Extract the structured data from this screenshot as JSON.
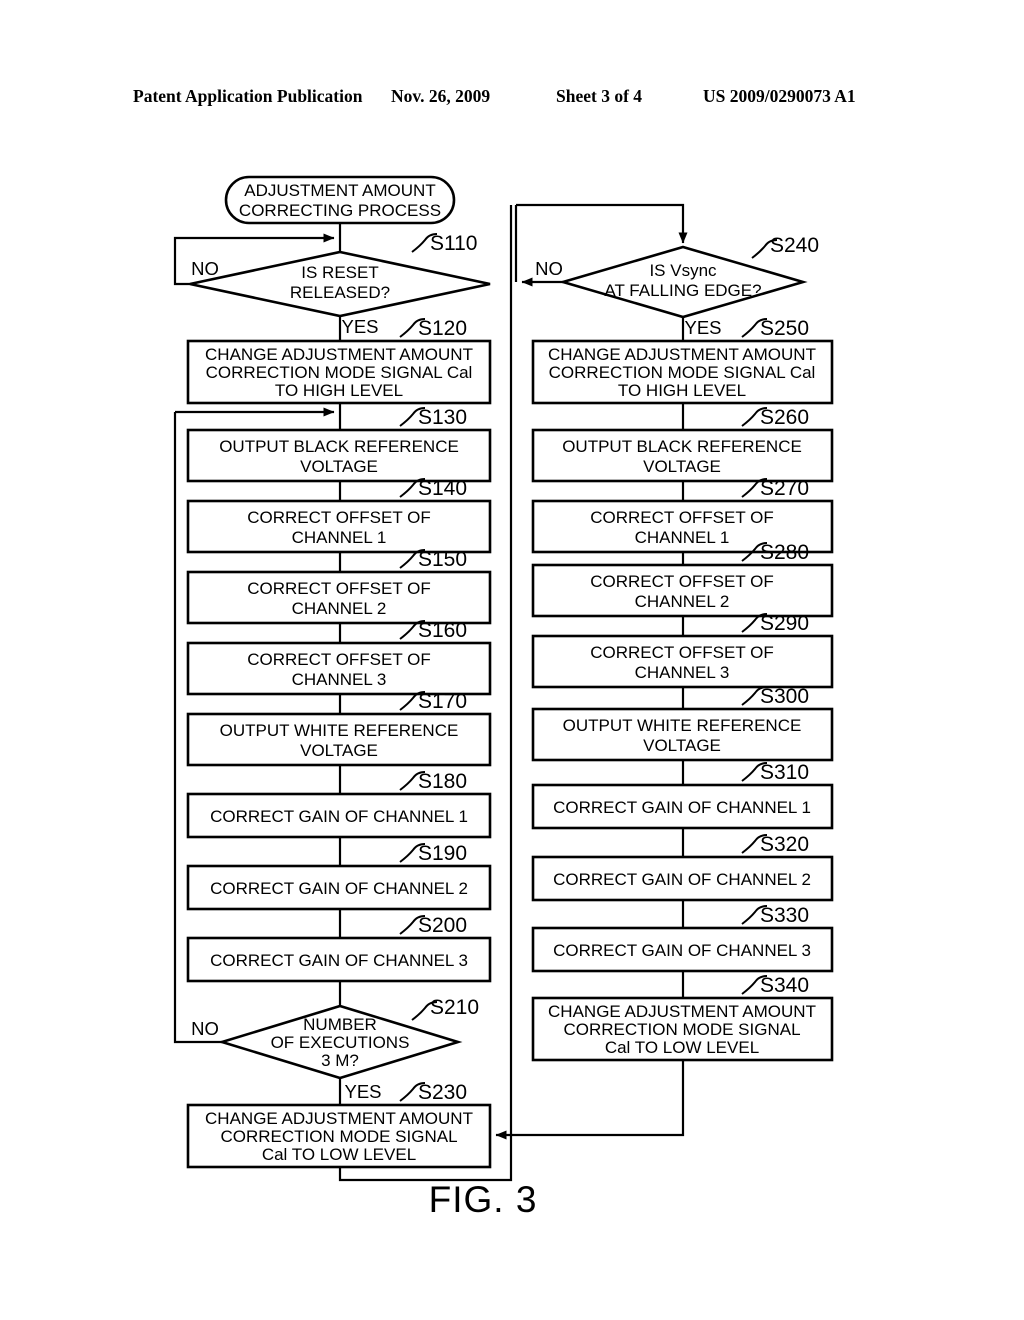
{
  "header": {
    "publication": "Patent Application Publication",
    "date": "Nov. 26, 2009",
    "sheet": "Sheet 3 of 4",
    "patent_number": "US 2009/0290073 A1"
  },
  "figure": {
    "label": "FIG. 3"
  },
  "flowchart": {
    "title": "ADJUSTMENT AMOUNT CORRECTING PROCESS",
    "start_terminal": {
      "line1": "ADJUSTMENT AMOUNT",
      "line2": "CORRECTING PROCESS"
    },
    "yes_label": "YES",
    "no_label": "NO",
    "left_column": [
      {
        "step": "S110",
        "shape": "decision",
        "lines": [
          "IS RESET",
          "RELEASED?"
        ],
        "yes": "YES",
        "no": "NO"
      },
      {
        "step": "S120",
        "shape": "process",
        "lines": [
          "CHANGE ADJUSTMENT AMOUNT",
          "CORRECTION MODE SIGNAL Cal",
          "TO HIGH LEVEL"
        ]
      },
      {
        "step": "S130",
        "shape": "process",
        "lines": [
          "OUTPUT BLACK REFERENCE",
          "VOLTAGE"
        ]
      },
      {
        "step": "S140",
        "shape": "process",
        "lines": [
          "CORRECT OFFSET OF",
          "CHANNEL 1"
        ]
      },
      {
        "step": "S150",
        "shape": "process",
        "lines": [
          "CORRECT OFFSET OF",
          "CHANNEL 2"
        ]
      },
      {
        "step": "S160",
        "shape": "process",
        "lines": [
          "CORRECT OFFSET OF",
          "CHANNEL 3"
        ]
      },
      {
        "step": "S170",
        "shape": "process",
        "lines": [
          "OUTPUT WHITE REFERENCE",
          "VOLTAGE"
        ]
      },
      {
        "step": "S180",
        "shape": "process",
        "lines": [
          "CORRECT GAIN OF CHANNEL 1"
        ]
      },
      {
        "step": "S190",
        "shape": "process",
        "lines": [
          "CORRECT GAIN OF CHANNEL 2"
        ]
      },
      {
        "step": "S200",
        "shape": "process",
        "lines": [
          "CORRECT GAIN OF CHANNEL 3"
        ]
      },
      {
        "step": "S210",
        "shape": "decision",
        "lines": [
          "NUMBER",
          "OF EXECUTIONS",
          "3 M?"
        ],
        "yes": "YES",
        "no": "NO"
      },
      {
        "step": "S230",
        "shape": "process",
        "lines": [
          "CHANGE ADJUSTMENT AMOUNT",
          "CORRECTION MODE SIGNAL",
          "Cal TO LOW LEVEL"
        ]
      }
    ],
    "right_column": [
      {
        "step": "S240",
        "shape": "decision",
        "lines": [
          "IS Vsync",
          "AT FALLING EDGE?"
        ],
        "yes": "YES",
        "no": "NO"
      },
      {
        "step": "S250",
        "shape": "process",
        "lines": [
          "CHANGE ADJUSTMENT AMOUNT",
          "CORRECTION MODE SIGNAL Cal",
          "TO HIGH LEVEL"
        ]
      },
      {
        "step": "S260",
        "shape": "process",
        "lines": [
          "OUTPUT BLACK REFERENCE",
          "VOLTAGE"
        ]
      },
      {
        "step": "S270",
        "shape": "process",
        "lines": [
          "CORRECT OFFSET OF",
          "CHANNEL 1"
        ]
      },
      {
        "step": "S280",
        "shape": "process",
        "lines": [
          "CORRECT OFFSET OF",
          "CHANNEL 2"
        ]
      },
      {
        "step": "S290",
        "shape": "process",
        "lines": [
          "CORRECT OFFSET OF",
          "CHANNEL 3"
        ]
      },
      {
        "step": "S300",
        "shape": "process",
        "lines": [
          "OUTPUT WHITE REFERENCE",
          "VOLTAGE"
        ]
      },
      {
        "step": "S310",
        "shape": "process",
        "lines": [
          "CORRECT GAIN OF CHANNEL 1"
        ]
      },
      {
        "step": "S320",
        "shape": "process",
        "lines": [
          "CORRECT GAIN OF CHANNEL 2"
        ]
      },
      {
        "step": "S330",
        "shape": "process",
        "lines": [
          "CORRECT GAIN OF CHANNEL 3"
        ]
      },
      {
        "step": "S340",
        "shape": "process",
        "lines": [
          "CHANGE ADJUSTMENT AMOUNT",
          "CORRECTION MODE SIGNAL",
          "Cal TO LOW LEVEL"
        ]
      }
    ]
  }
}
